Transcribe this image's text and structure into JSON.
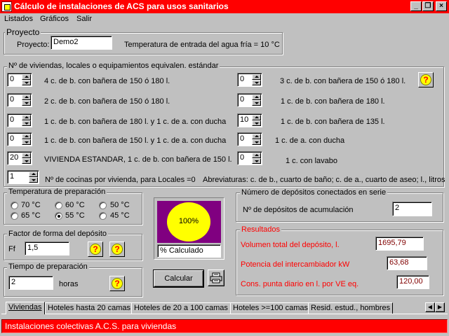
{
  "window": {
    "title": "Cálculo de instalaciones de ACS para usos sanitarios",
    "controls": {
      "minimize": "_",
      "restore": "❐",
      "close": "×"
    }
  },
  "menu": [
    "Listados",
    "Gráficos",
    "Salir"
  ],
  "proyecto": {
    "group_label": "Proyecto",
    "label": "Proyecto:",
    "value": "Demo2",
    "temp_info": "Temperatura de entrada del agua fría = 10 °C"
  },
  "viviendas": {
    "group_label": "Nº de viviendas, locales o equipamientos equivalen. estándar",
    "left": [
      {
        "value": "0",
        "label": "4 c. de b. con bañera de 150 ó 180 l."
      },
      {
        "value": "0",
        "label": "2 c. de b. con bañera de 150 ó 180 l."
      },
      {
        "value": "0",
        "label": "1 c. de b. con bañera de 180 l. y 1 c. de a. con ducha"
      },
      {
        "value": "0",
        "label": "1 c. de b. con bañera de 150 l. y 1 c. de a. con ducha"
      },
      {
        "value": "20",
        "label": "VIVIENDA ESTANDAR, 1 c. de b. con bañera de 150 l."
      }
    ],
    "right": [
      {
        "value": "0",
        "label": "3 c. de b. con bañera de 150 ó 180 l."
      },
      {
        "value": "0",
        "label": "1 c. de b. con bañera de 180 l."
      },
      {
        "value": "10",
        "label": "1 c. de b. con bañera de 135 l."
      },
      {
        "value": "0",
        "label": "1 c. de a. con ducha"
      },
      {
        "value": "0",
        "label": "1 c. con lavabo"
      }
    ],
    "cocinas": {
      "value": "1",
      "label": "Nº de cocinas por vivienda, para Locales =0"
    },
    "abreviaturas": "Abreviaturas: c. de b., cuarto de baño; c. de a., cuarto de aseo; l., litros"
  },
  "temperatura": {
    "group_label": "Temperatura de preparación",
    "options": [
      "70 °C",
      "60 °C",
      "50 °C",
      "65 °C",
      "55 °C",
      "45 °C"
    ],
    "selected": "55 °C"
  },
  "factor": {
    "group_label": "Factor de forma del depósito",
    "label": "Ff",
    "value": "1,5"
  },
  "tiempo": {
    "group_label": "Tiempo de preparación",
    "value": "2",
    "unit": "horas"
  },
  "progress": {
    "percent": 100,
    "label": "100%",
    "status": "% Calculado",
    "colors": {
      "panel": "#800080",
      "circle": "#ffff00",
      "fill": "#ff0000"
    }
  },
  "buttons": {
    "calcular": "Calcular",
    "print_icon": "printer-icon"
  },
  "depositos": {
    "group_label": "Número de depósitos conectados en serie",
    "label": "Nº de depósitos de acumulación",
    "value": "2"
  },
  "resultados": {
    "group_label": "Resultados",
    "items": [
      {
        "label": "Volumen total del depósito, l.",
        "value": "1695,79"
      },
      {
        "label": "Potencia del intercambiador kW",
        "value": "63,68"
      },
      {
        "label": "Cons. punta diario en l. por VE eq.",
        "value": "120,00"
      }
    ]
  },
  "tabs": [
    "Viviendas",
    "Hoteles hasta 20 camas",
    "Hoteles de 20 a 100 camas",
    "Hoteles >=100 camas",
    "Resid. estud., hombres"
  ],
  "status": "Instalaciones colectivas A.C.S. para viviendas"
}
